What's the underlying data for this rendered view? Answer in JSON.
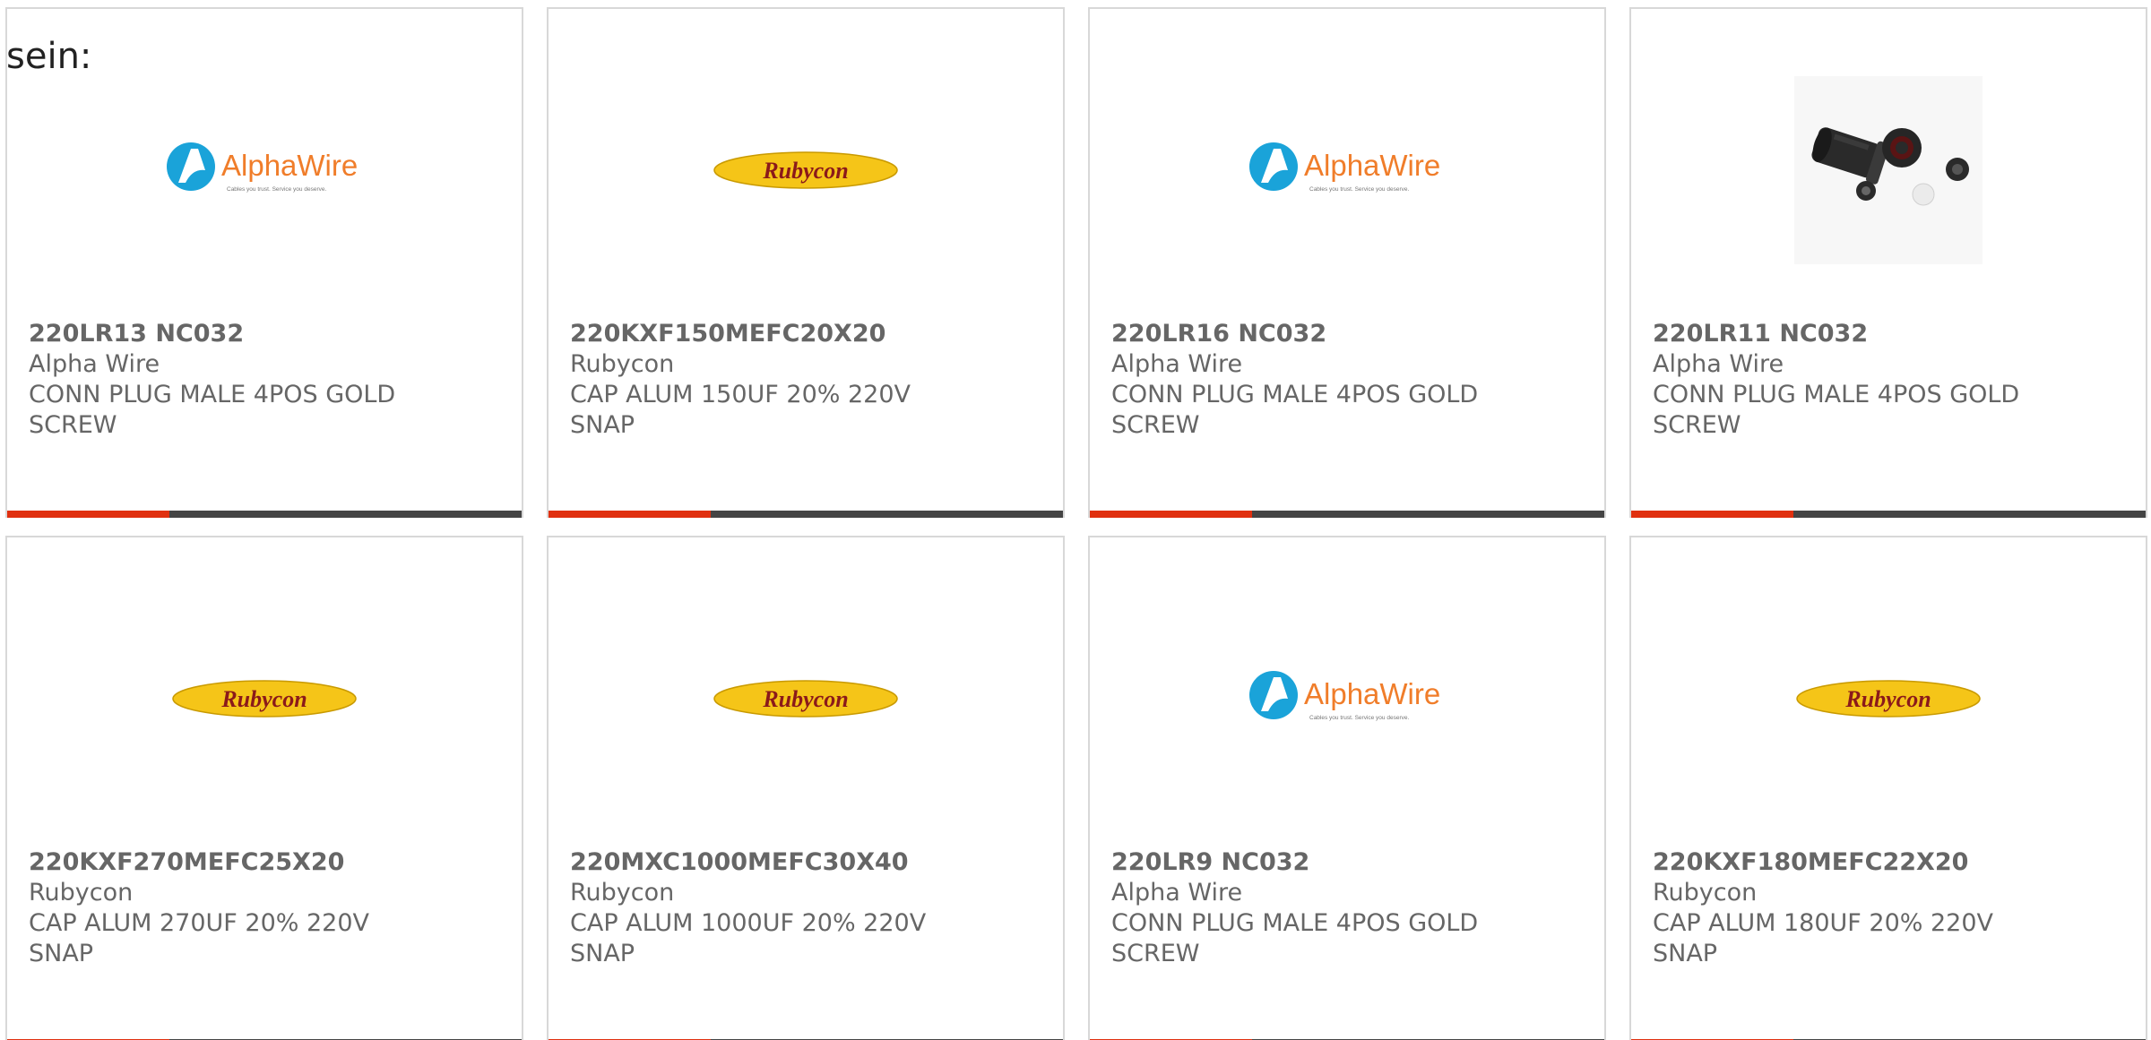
{
  "intro": {
    "text": "sein:"
  },
  "colors": {
    "accent": "#e0300f",
    "bar": "#444444",
    "text": "#666666",
    "rubycon_yellow": "#f5c518",
    "rubycon_red": "#8b1a1a",
    "alphawire_blue": "#1aa3d9",
    "alphawire_orange": "#f07d2a"
  },
  "products": [
    {
      "part_number": "220LR13 NC032",
      "manufacturer": "Alpha Wire",
      "description": "CONN PLUG MALE 4POS GOLD SCREW",
      "image": "alphawire-logo",
      "logo_text": "AlphaWire",
      "logo_tagline": "Cables you trust. Service you deserve."
    },
    {
      "part_number": "220KXF150MEFC20X20",
      "manufacturer": "Rubycon",
      "description": "CAP ALUM 150UF 20% 220V SNAP",
      "image": "rubycon-logo",
      "logo_text": "Rubycon"
    },
    {
      "part_number": "220LR16 NC032",
      "manufacturer": "Alpha Wire",
      "description": "CONN PLUG MALE 4POS GOLD SCREW",
      "image": "alphawire-logo",
      "logo_text": "AlphaWire",
      "logo_tagline": "Cables you trust. Service you deserve."
    },
    {
      "part_number": "220LR11 NC032",
      "manufacturer": "Alpha Wire",
      "description": "CONN PLUG MALE 4POS GOLD SCREW",
      "image": "connector-photo"
    },
    {
      "part_number": "220KXF270MEFC25X20",
      "manufacturer": "Rubycon",
      "description": "CAP ALUM 270UF 20% 220V SNAP",
      "image": "rubycon-logo",
      "logo_text": "Rubycon"
    },
    {
      "part_number": "220MXC1000MEFC30X40",
      "manufacturer": "Rubycon",
      "description": "CAP ALUM 1000UF 20% 220V SNAP",
      "image": "rubycon-logo",
      "logo_text": "Rubycon"
    },
    {
      "part_number": "220LR9 NC032",
      "manufacturer": "Alpha Wire",
      "description": "CONN PLUG MALE 4POS GOLD SCREW",
      "image": "alphawire-logo",
      "logo_text": "AlphaWire",
      "logo_tagline": "Cables you trust. Service you deserve."
    },
    {
      "part_number": "220KXF180MEFC22X20",
      "manufacturer": "Rubycon",
      "description": "CAP ALUM 180UF 20% 220V SNAP",
      "image": "rubycon-logo",
      "logo_text": "Rubycon"
    }
  ]
}
